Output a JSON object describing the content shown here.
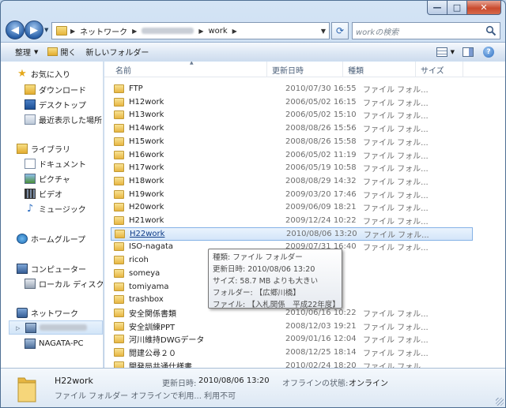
{
  "window": {
    "caption": {
      "minimize": "—",
      "maximize": "□",
      "close": "✕"
    }
  },
  "address": {
    "crumbs": [
      "ネットワーク",
      "work"
    ],
    "search_placeholder": "workの検索"
  },
  "toolbar": {
    "organize": "整理",
    "open": "開く",
    "new_folder": "新しいフォルダー",
    "help": "?"
  },
  "navigation": {
    "favorites": {
      "label": "お気に入り",
      "items": [
        "ダウンロード",
        "デスクトップ",
        "最近表示した場所"
      ]
    },
    "libraries": {
      "label": "ライブラリ",
      "items": [
        "ドキュメント",
        "ピクチャ",
        "ビデオ",
        "ミュージック"
      ]
    },
    "homegroup": "ホームグループ",
    "computer": {
      "label": "コンピューター",
      "items": [
        "ローカル ディスク (C"
      ]
    },
    "network": {
      "label": "ネットワーク",
      "items": [
        "",
        "NAGATA-PC"
      ]
    }
  },
  "columns": {
    "name": "名前",
    "date": "更新日時",
    "type": "種類",
    "size": "サイズ"
  },
  "files": [
    {
      "name": "FTP",
      "date": "2010/07/30 16:55",
      "type": "ファイル フォル..."
    },
    {
      "name": "H12work",
      "date": "2006/05/02 16:15",
      "type": "ファイル フォル..."
    },
    {
      "name": "H13work",
      "date": "2006/05/02 15:10",
      "type": "ファイル フォル..."
    },
    {
      "name": "H14work",
      "date": "2008/08/26 15:56",
      "type": "ファイル フォル..."
    },
    {
      "name": "H15work",
      "date": "2008/08/26 15:58",
      "type": "ファイル フォル..."
    },
    {
      "name": "H16work",
      "date": "2006/05/02 11:19",
      "type": "ファイル フォル..."
    },
    {
      "name": "H17work",
      "date": "2006/05/19 10:58",
      "type": "ファイル フォル..."
    },
    {
      "name": "H18work",
      "date": "2008/08/29 14:32",
      "type": "ファイル フォル..."
    },
    {
      "name": "H19work",
      "date": "2009/03/20 17:46",
      "type": "ファイル フォル..."
    },
    {
      "name": "H20work",
      "date": "2009/06/09 18:21",
      "type": "ファイル フォル..."
    },
    {
      "name": "H21work",
      "date": "2009/12/24 10:22",
      "type": "ファイル フォル..."
    },
    {
      "name": "H22work",
      "date": "2010/08/06 13:20",
      "type": "ファイル フォル...",
      "selected": true
    },
    {
      "name": "ISO-nagata",
      "date": "2009/07/31 16:40",
      "type": "ファイル フォル..."
    },
    {
      "name": "ricoh",
      "date": "",
      "type": ""
    },
    {
      "name": "someya",
      "date": "",
      "type": ""
    },
    {
      "name": "tomiyama",
      "date": "",
      "type": ""
    },
    {
      "name": "trashbox",
      "date": "",
      "type": ""
    },
    {
      "name": "安全関係書類",
      "date": "2010/06/16 10:22",
      "type": "ファイル フォル..."
    },
    {
      "name": "安全訓練PPT",
      "date": "2008/12/03 19:21",
      "type": "ファイル フォル..."
    },
    {
      "name": "河川維持DWGデータ",
      "date": "2009/01/16 12:04",
      "type": "ファイル フォル..."
    },
    {
      "name": "閲建公尋２０",
      "date": "2008/12/25 18:14",
      "type": "ファイル フォル..."
    },
    {
      "name": "開発局共通仕様書",
      "date": "2010/02/24 18:20",
      "type": "ファイル フォル..."
    }
  ],
  "tooltip": {
    "lines": [
      "種類: ファイル フォルダー",
      "更新日時: 2010/08/06 13:20",
      "サイズ: 58.7 MB よりも大きい",
      "フォルダー: 【広郷川橋】",
      "ファイル: 【入札関係　平成22年度】"
    ]
  },
  "details": {
    "name": "H22work",
    "type_line": "ファイル フォルダー オフラインで利用...  利用不可",
    "modified_label": "更新日時:",
    "modified_value": "2010/08/06 13:20",
    "offline_label": "オフラインの状態:",
    "offline_value": "オンライン"
  },
  "colors": {
    "selection": "#d3e5f9",
    "selection_border": "#85b2e6",
    "folder": "#e7b642",
    "close_button": "#c94a2e"
  }
}
